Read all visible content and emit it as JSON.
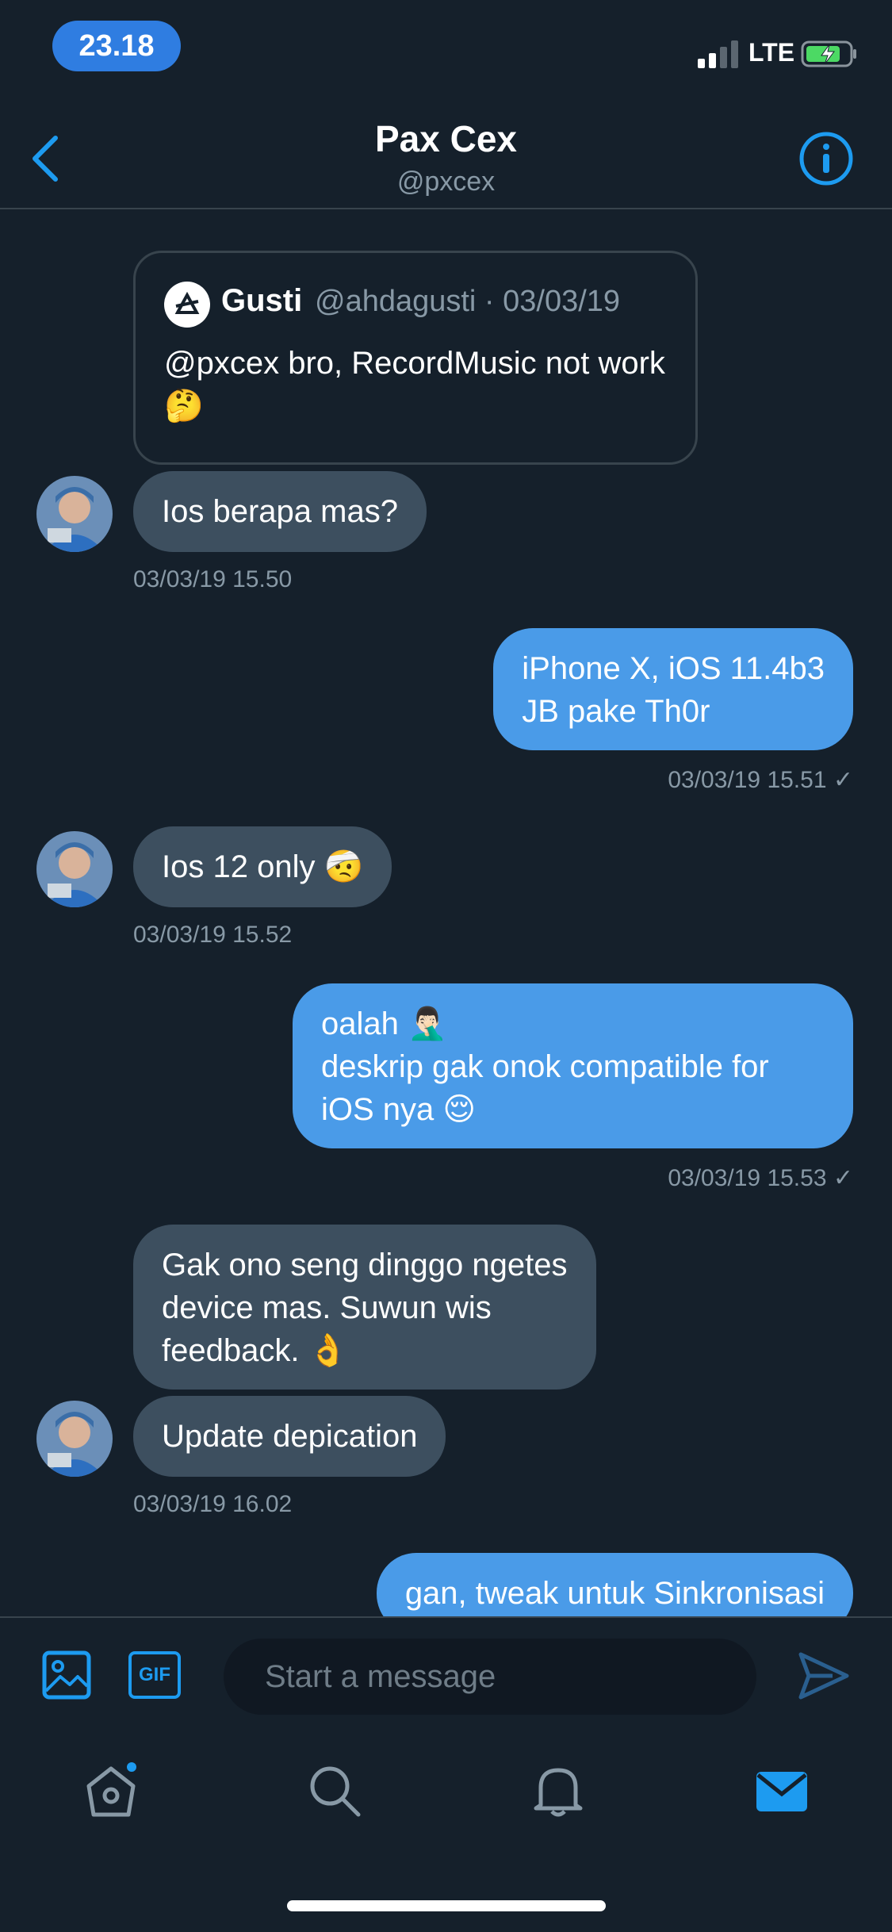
{
  "status_bar": {
    "time": "23.18",
    "network": "LTE"
  },
  "header": {
    "title": "Pax Cex",
    "handle": "@pxcex"
  },
  "quoted_tweet": {
    "name": "Gusti",
    "meta": "@ahdagusti · 03/03/19",
    "text": "@pxcex bro, RecordMusic not work 🤔"
  },
  "messages": [
    {
      "text": "Ios berapa mas?",
      "timestamp": "03/03/19 15.50"
    },
    {
      "text": "iPhone X, iOS 11.4b3\nJB pake Th0r",
      "timestamp": "03/03/19 15.51 ✓"
    },
    {
      "text": "Ios 12 only 🤕",
      "timestamp": "03/03/19 15.52"
    },
    {
      "text": "oalah 🤦🏻‍♂️\ndeskrip gak onok compatible for\niOS nya 😌",
      "timestamp": "03/03/19 15.53 ✓"
    },
    {
      "text": "Gak ono seng dinggo ngetes\ndevice mas. Suwun wis\nfeedback. 👌"
    },
    {
      "text": "Update depication",
      "timestamp": "03/03/19 16.02"
    },
    {
      "text": "gan, tweak untuk Sinkronisasi"
    }
  ],
  "composer": {
    "gif_label": "GIF",
    "placeholder": "Start a message"
  },
  "tabs": [
    "home-icon",
    "search-icon",
    "bell-icon",
    "mail-icon"
  ],
  "colors": {
    "accent": "#1d9bf0",
    "background": "#15202b",
    "incoming": "#3d4f5f",
    "outgoing": "#4a9be8"
  }
}
